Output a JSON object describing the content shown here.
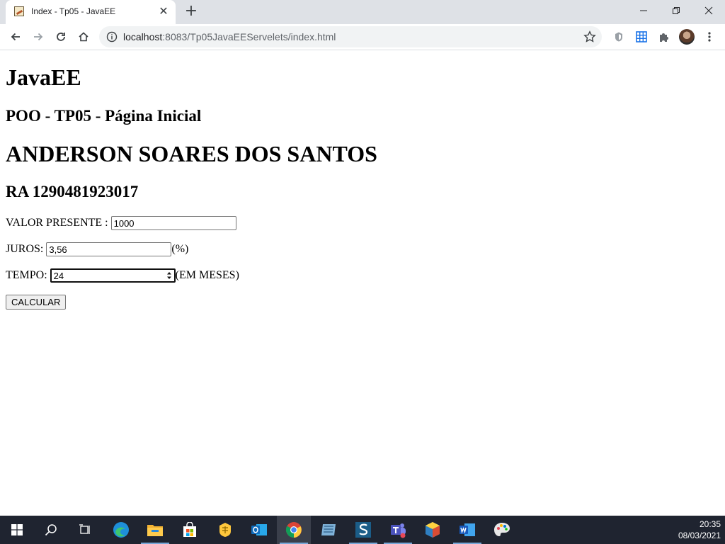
{
  "browser": {
    "tab_title": "Index - Tp05 - JavaEE",
    "tab_close": "✕",
    "new_tab": "+",
    "url_host": "localhost",
    "url_rest": ":8083/Tp05JavaEEServelets/index.html"
  },
  "page": {
    "heading1": "JavaEE",
    "heading2": "POO - TP05 - Página Inicial",
    "student_name": "ANDERSON SOARES DOS SANTOS",
    "student_ra": "RA 1290481923017",
    "form": {
      "valor_label": "VALOR PRESENTE :",
      "valor_value": "1000",
      "juros_label": "JUROS:",
      "juros_value": "3,56",
      "juros_suffix": "(%)",
      "tempo_label": "TEMPO:",
      "tempo_value": "24",
      "tempo_suffix": "(EM MESES)",
      "submit_label": "CALCULAR"
    }
  },
  "taskbar": {
    "apps": [
      "start-icon",
      "search-icon",
      "task-view-icon",
      "edge-icon",
      "file-explorer-icon",
      "store-icon",
      "pin-app-icon",
      "outlook-icon",
      "chrome-icon",
      "window-app-icon",
      "s-app-icon",
      "teams-icon",
      "cube-app-icon",
      "word-icon",
      "paint-icon"
    ],
    "time": "20:35",
    "date": "08/03/2021"
  },
  "colors": {
    "tabstrip_bg": "#dee1e6",
    "omnibox_bg": "#f1f3f4",
    "taskbar_bg": "#1f2430",
    "taskbar_active": "#3a3f4b"
  }
}
